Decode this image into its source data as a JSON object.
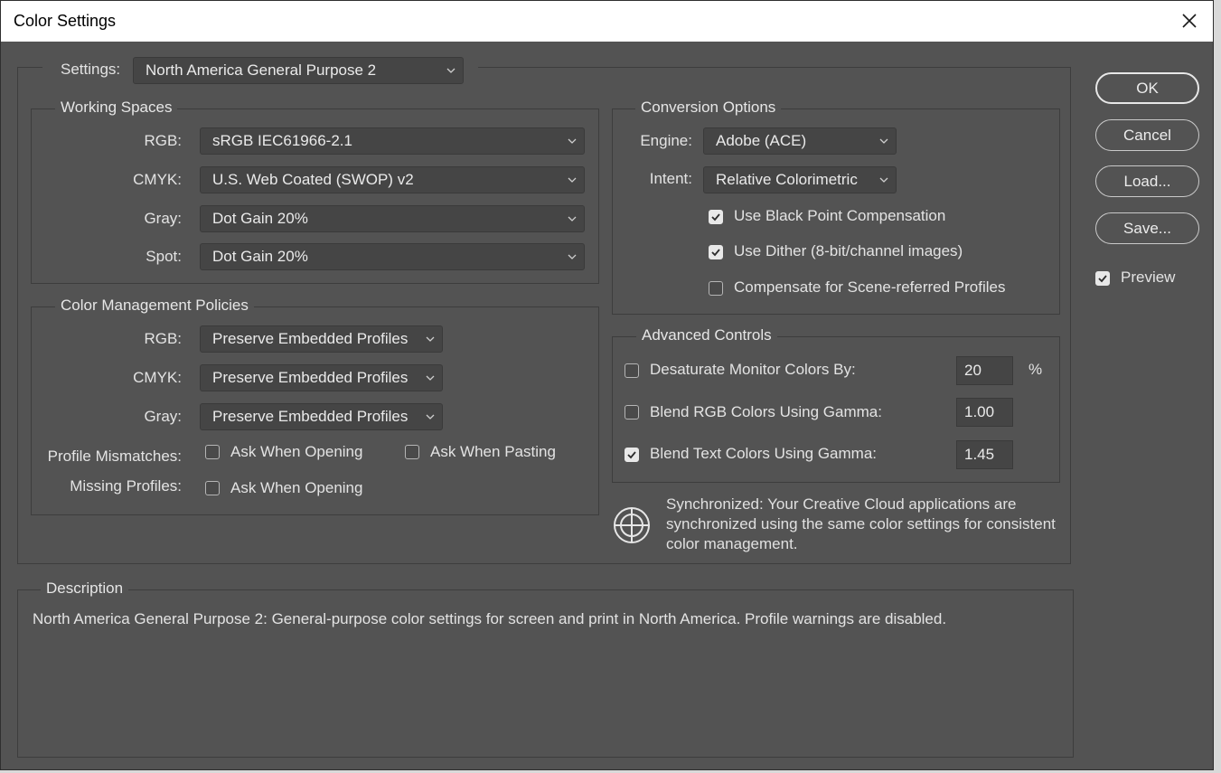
{
  "window": {
    "title": "Color Settings"
  },
  "settings": {
    "label": "Settings:",
    "value": "North America General Purpose 2"
  },
  "working_spaces": {
    "legend": "Working Spaces",
    "rgb": {
      "label": "RGB:",
      "value": "sRGB IEC61966-2.1"
    },
    "cmyk": {
      "label": "CMYK:",
      "value": "U.S. Web Coated (SWOP) v2"
    },
    "gray": {
      "label": "Gray:",
      "value": "Dot Gain 20%"
    },
    "spot": {
      "label": "Spot:",
      "value": "Dot Gain 20%"
    }
  },
  "policies": {
    "legend": "Color Management Policies",
    "rgb": {
      "label": "RGB:",
      "value": "Preserve Embedded Profiles"
    },
    "cmyk": {
      "label": "CMYK:",
      "value": "Preserve Embedded Profiles"
    },
    "gray": {
      "label": "Gray:",
      "value": "Preserve Embedded Profiles"
    },
    "mismatch_label": "Profile Mismatches:",
    "mismatch_open": {
      "label": "Ask When Opening",
      "checked": false
    },
    "mismatch_paste": {
      "label": "Ask When Pasting",
      "checked": false
    },
    "missing_label": "Missing Profiles:",
    "missing_open": {
      "label": "Ask When Opening",
      "checked": false
    }
  },
  "conversion": {
    "legend": "Conversion Options",
    "engine": {
      "label": "Engine:",
      "value": "Adobe (ACE)"
    },
    "intent": {
      "label": "Intent:",
      "value": "Relative Colorimetric"
    },
    "black_point": {
      "label": "Use Black Point Compensation",
      "checked": true
    },
    "dither": {
      "label": "Use Dither (8-bit/channel images)",
      "checked": true
    },
    "scene_referred": {
      "label": "Compensate for Scene-referred Profiles",
      "checked": false
    }
  },
  "advanced": {
    "legend": "Advanced Controls",
    "desaturate": {
      "label": "Desaturate Monitor Colors By:",
      "checked": false,
      "value": "20",
      "unit": "%"
    },
    "blend_rgb": {
      "label": "Blend RGB Colors Using Gamma:",
      "checked": false,
      "value": "1.00"
    },
    "blend_text": {
      "label": "Blend Text Colors Using Gamma:",
      "checked": true,
      "value": "1.45"
    }
  },
  "sync": {
    "text": "Synchronized: Your Creative Cloud applications are synchronized using the same color settings for consistent color management."
  },
  "description": {
    "legend": "Description",
    "text": "North America General Purpose 2:  General-purpose color settings for screen and print in North America. Profile warnings are disabled."
  },
  "buttons": {
    "ok": "OK",
    "cancel": "Cancel",
    "load": "Load...",
    "save": "Save..."
  },
  "preview": {
    "label": "Preview",
    "checked": true
  },
  "colors": {
    "dialog_bg": "#535353",
    "field_bg": "#454545",
    "text": "#e3e3e3",
    "titlebar": "#ffffff"
  }
}
